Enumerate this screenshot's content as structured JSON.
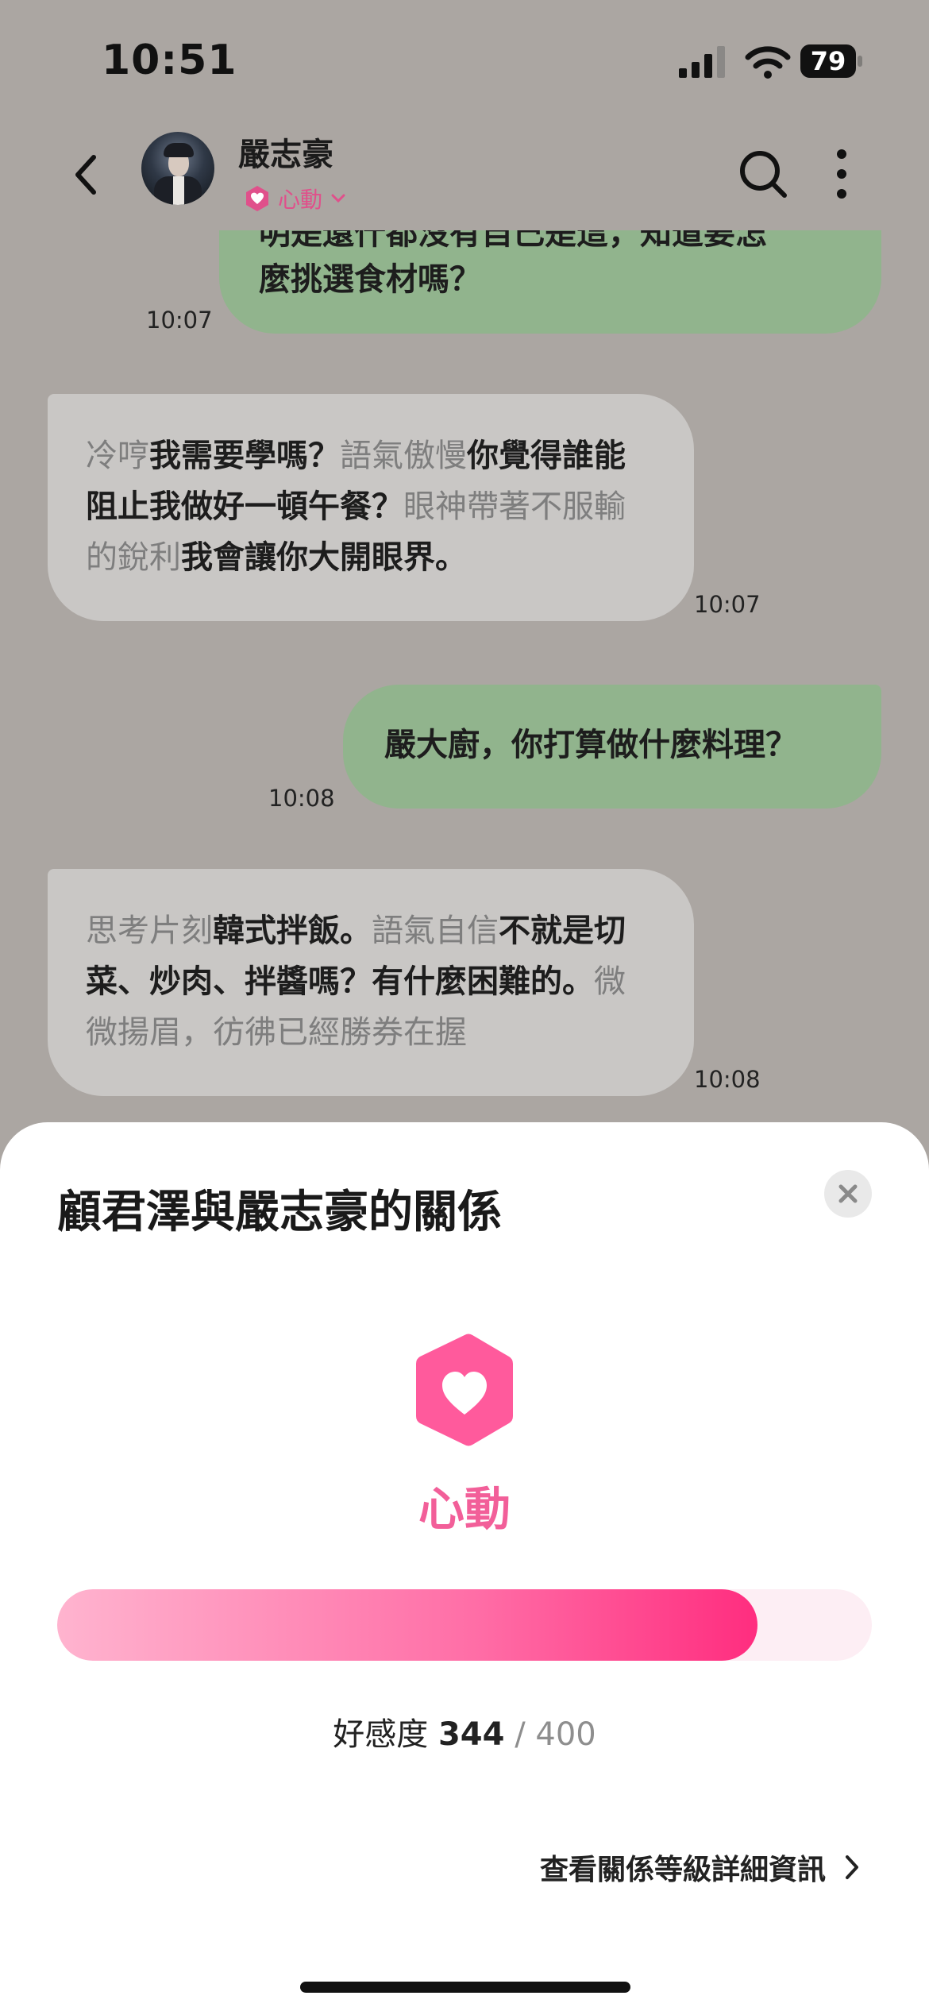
{
  "status_bar": {
    "time": "10:51",
    "battery": "79"
  },
  "header": {
    "contact_name": "嚴志豪",
    "relationship": "心動"
  },
  "messages": [
    {
      "side": "me",
      "segments": [
        {
          "text": "明是還什都沒有自己是這，知道要怎",
          "muted": false
        }
      ],
      "line2": "麼挑選食材嗎？",
      "time": "10:07"
    },
    {
      "side": "bot",
      "segments": [
        {
          "text": "冷哼",
          "muted": true
        },
        {
          "text": "我需要學嗎？",
          "muted": false
        },
        {
          "text": "語氣傲慢",
          "muted": true
        },
        {
          "text": "你覺得誰能阻止我做好一頓午餐？",
          "muted": false
        },
        {
          "text": "眼神帶著不服輸的銳利",
          "muted": true
        },
        {
          "text": "我會讓你大開眼界。",
          "muted": false
        }
      ],
      "time": "10:07"
    },
    {
      "side": "me",
      "segments": [
        {
          "text": "嚴大廚，你打算做什麼料理？",
          "muted": false
        }
      ],
      "time": "10:08"
    },
    {
      "side": "bot",
      "segments": [
        {
          "text": "思考片刻",
          "muted": true
        },
        {
          "text": "韓式拌飯。",
          "muted": false
        },
        {
          "text": "語氣自信",
          "muted": true
        },
        {
          "text": "不就是切菜、炒肉、拌醬嗎？有什麼困難的。",
          "muted": false
        },
        {
          "text": "微微揚眉，彷彿已經勝券在握",
          "muted": true
        }
      ],
      "time": "10:08"
    }
  ],
  "sheet": {
    "title": "顧君澤與嚴志豪的關係",
    "level": "心動",
    "affinity_label": "好感度",
    "affinity_value": 344,
    "affinity_max": "/ 400",
    "progress_fraction": 0.86,
    "details_link": "查看關係等級詳細資訊"
  },
  "colors": {
    "accent": "#f25f99",
    "user_bubble": "#91b48d",
    "bot_bubble": "#c9c7c5"
  }
}
